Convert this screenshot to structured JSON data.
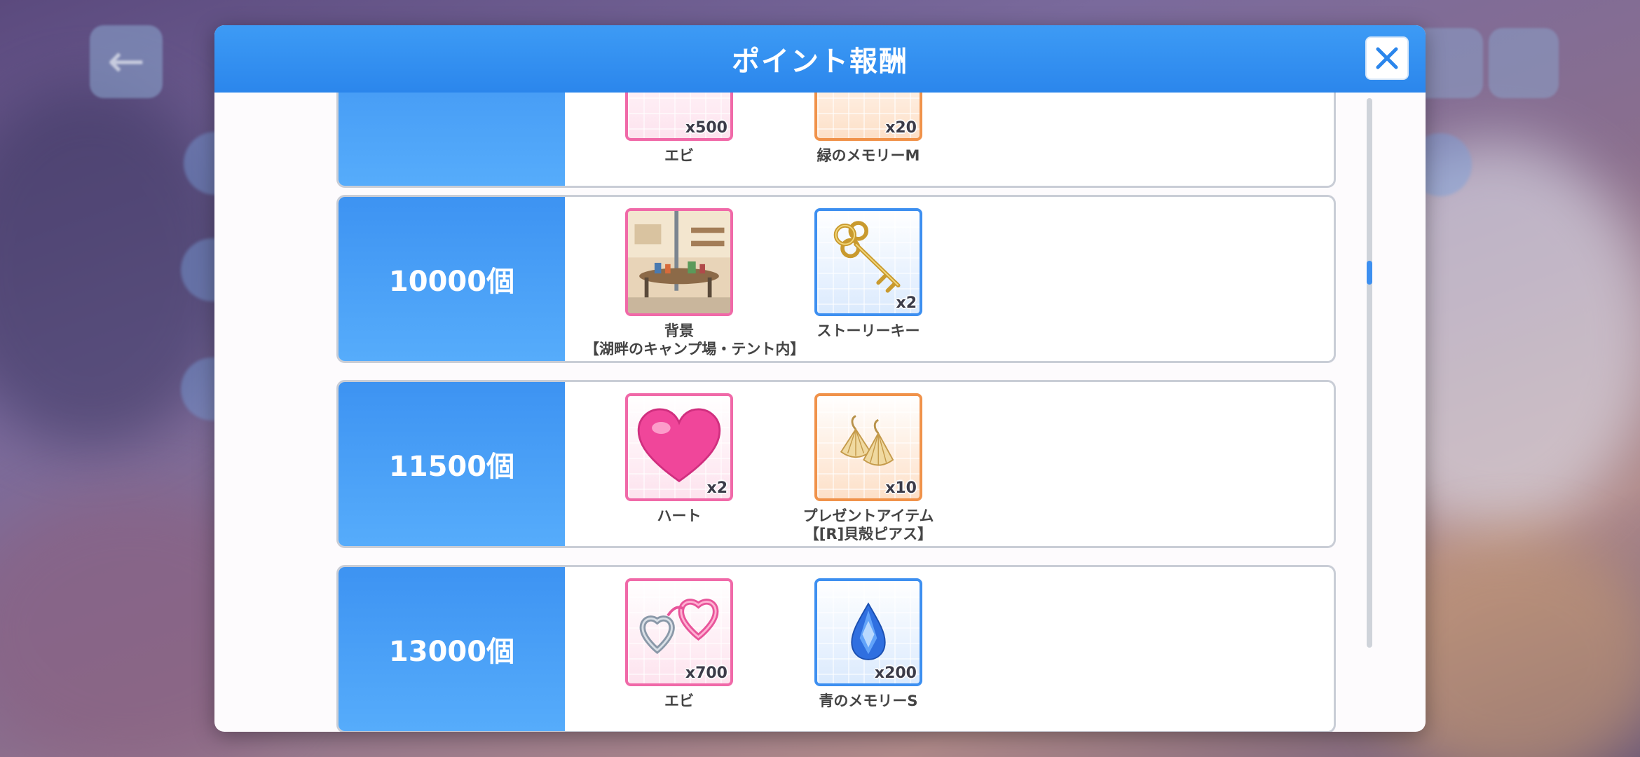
{
  "dialog": {
    "title": "ポイント報酬",
    "close_label": "×"
  },
  "rows": [
    {
      "threshold": "",
      "items": [
        {
          "name": "エビ",
          "qty": "x500",
          "frame": "pink",
          "icon": "handcuffs-icon"
        },
        {
          "name": "緑のメモリーM",
          "qty": "x20",
          "frame": "orange",
          "icon": "memory-icon"
        }
      ]
    },
    {
      "threshold": "10000個",
      "items": [
        {
          "name_line1": "背景",
          "name_line2": "【湖畔のキャンプ場・テント内】",
          "qty": "",
          "frame": "pink",
          "icon": "background-icon"
        },
        {
          "name": "ストーリーキー",
          "qty": "x2",
          "frame": "blue",
          "icon": "key-icon"
        }
      ]
    },
    {
      "threshold": "11500個",
      "items": [
        {
          "name": "ハート",
          "qty": "x2",
          "frame": "pink",
          "icon": "heart-icon"
        },
        {
          "name_line1": "プレゼントアイテム",
          "name_line2": "【[R]貝殻ピアス】",
          "qty": "x10",
          "frame": "orange",
          "icon": "earrings-icon"
        }
      ]
    },
    {
      "threshold": "13000個",
      "items": [
        {
          "name": "エビ",
          "qty": "x700",
          "frame": "pink",
          "icon": "handcuffs-icon"
        },
        {
          "name": "青のメモリーS",
          "qty": "x200",
          "frame": "blue",
          "icon": "water-drop-icon"
        }
      ]
    }
  ],
  "colors": {
    "header": "#2b86ec",
    "accent_blue": "#3d8ff0",
    "pink_frame": "#f069a8",
    "orange_frame": "#f0924a"
  },
  "scroll": {
    "position_fraction": 0.32
  }
}
